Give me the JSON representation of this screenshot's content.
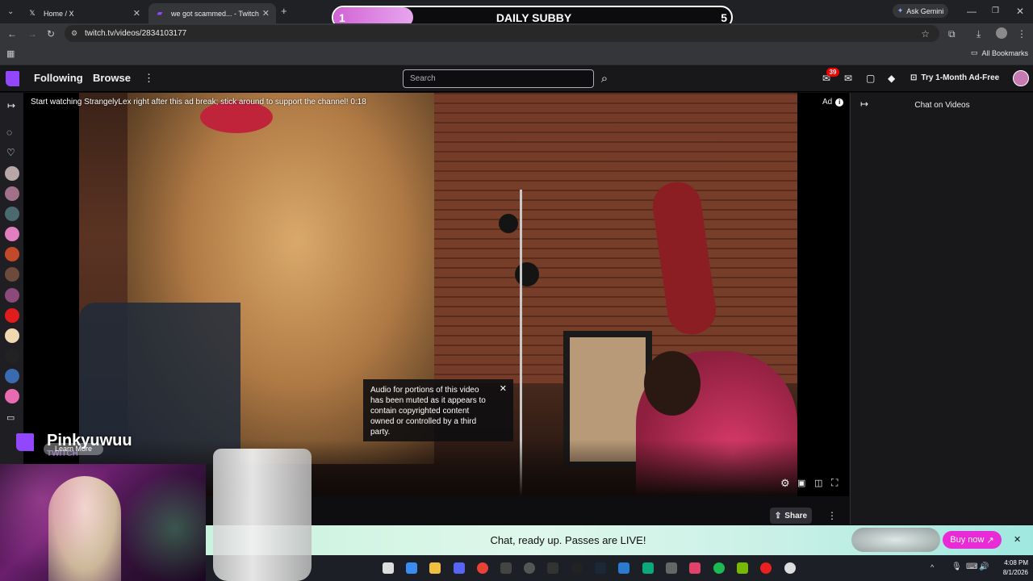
{
  "browser": {
    "tabs": [
      {
        "title": "Home / X",
        "favicon": "x-logo-icon"
      },
      {
        "title": "we got scammed... - Twitch",
        "favicon": "twitch-icon",
        "active": true
      }
    ],
    "url": "twitch.tv/videos/2834103177",
    "ask_gemini": "Ask Gemini",
    "all_bookmarks": "All Bookmarks"
  },
  "subby_overlay": {
    "title": "DAILY SUBBY",
    "current": "1",
    "goal": "5",
    "progress": 0.2
  },
  "twitch": {
    "nav": {
      "following": "Following",
      "browse": "Browse",
      "search_placeholder": "Search",
      "notif_count": "39",
      "try_adfree": "Try 1-Month Ad-Free"
    },
    "ad_message": "Start watching StrangelyLex right after this ad break; stick around to support the channel! 0:18",
    "ad_label": "Ad",
    "chat_title": "Chat on Videos",
    "mute_notice": "Audio for portions of this video has been muted as it appears to contain copyrighted content owned or controlled by a third party.",
    "share_label": "Share",
    "banner_text": "Chat, ready up. Passes are LIVE!",
    "buy_now": "Buy now",
    "learn_more": "Learn More",
    "streamer_name": "Pinkyuwuu",
    "streamer_sub": "TWITCH"
  },
  "taskbar": {
    "time": "4:08 PM",
    "date": "8/1/2026"
  },
  "colors": {
    "twitch_purple": "#9146ff",
    "subby_pink": "#d262d5",
    "notif_red": "#eb0400",
    "buy_pink": "#e82bd6"
  }
}
